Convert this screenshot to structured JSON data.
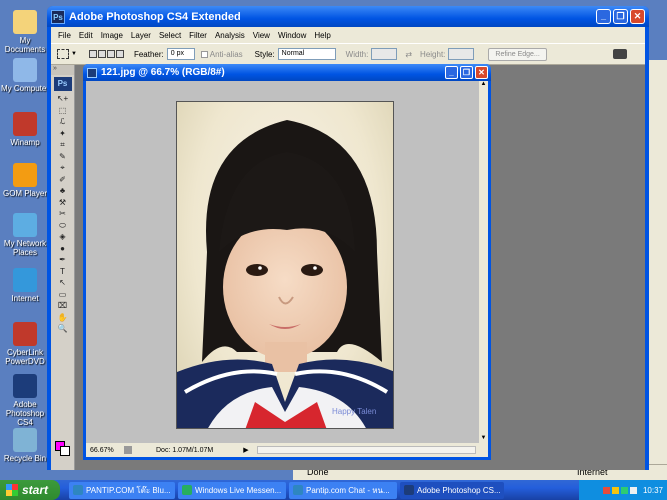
{
  "desktop_icons": [
    {
      "label": "My Documents",
      "color": "#f4d37a"
    },
    {
      "label": "My Computer",
      "color": "#8fb8e8"
    },
    {
      "label": "Winamp",
      "color": "#c0392b"
    },
    {
      "label": "GOM Player",
      "color": "#f39c12"
    },
    {
      "label": "My Network Places",
      "color": "#5dade2"
    },
    {
      "label": "Internet",
      "color": "#3498db"
    },
    {
      "label": "CyberLink PowerDVD",
      "color": "#c0392b"
    },
    {
      "label": "Adobe Photoshop CS4",
      "color": "#1c3c7a"
    },
    {
      "label": "Recycle Bin",
      "color": "#7fb3d5"
    }
  ],
  "app": {
    "title": "Adobe Photoshop CS4 Extended",
    "menu": [
      "File",
      "Edit",
      "Image",
      "Layer",
      "Select",
      "Filter",
      "Analysis",
      "View",
      "Window",
      "Help"
    ]
  },
  "options": {
    "feather_label": "Feather:",
    "feather_value": "0 px",
    "antialias_label": "Anti-alias",
    "style_label": "Style:",
    "style_value": "Normal",
    "width_label": "Width:",
    "height_label": "Height:",
    "refine_edge_label": "Refine Edge..."
  },
  "tools_panel": {
    "logo": "Ps",
    "tools": [
      "↖+",
      "⬚",
      "ℒ",
      "✦",
      "⌗",
      "✎",
      "⌖",
      "✐",
      "♣",
      "⚒",
      "✂",
      "⬭",
      "◈",
      "●",
      "✒",
      "T",
      "↖",
      "▭",
      "⌧",
      "✋",
      "🔍"
    ]
  },
  "document": {
    "title": "121.jpg @ 66.7% (RGB/8#)",
    "zoom": "66.67%",
    "doc_info": "Doc: 1.07M/1.07M",
    "shirt_text": "Happy Talen"
  },
  "ie": {
    "status_left": "Done",
    "status_right": "Internet"
  },
  "taskbar": {
    "start_label": "start",
    "tasks": [
      {
        "label": "PANTIP.COM โต๊ะ Blu...",
        "color": "#2e86c1"
      },
      {
        "label": "Windows Live Messen...",
        "color": "#27ae60"
      },
      {
        "label": "Pantip.com Chat - หน...",
        "color": "#2e86c1"
      },
      {
        "label": "Adobe Photoshop CS...",
        "color": "#1c3c7a"
      }
    ],
    "clock": "10:37"
  }
}
